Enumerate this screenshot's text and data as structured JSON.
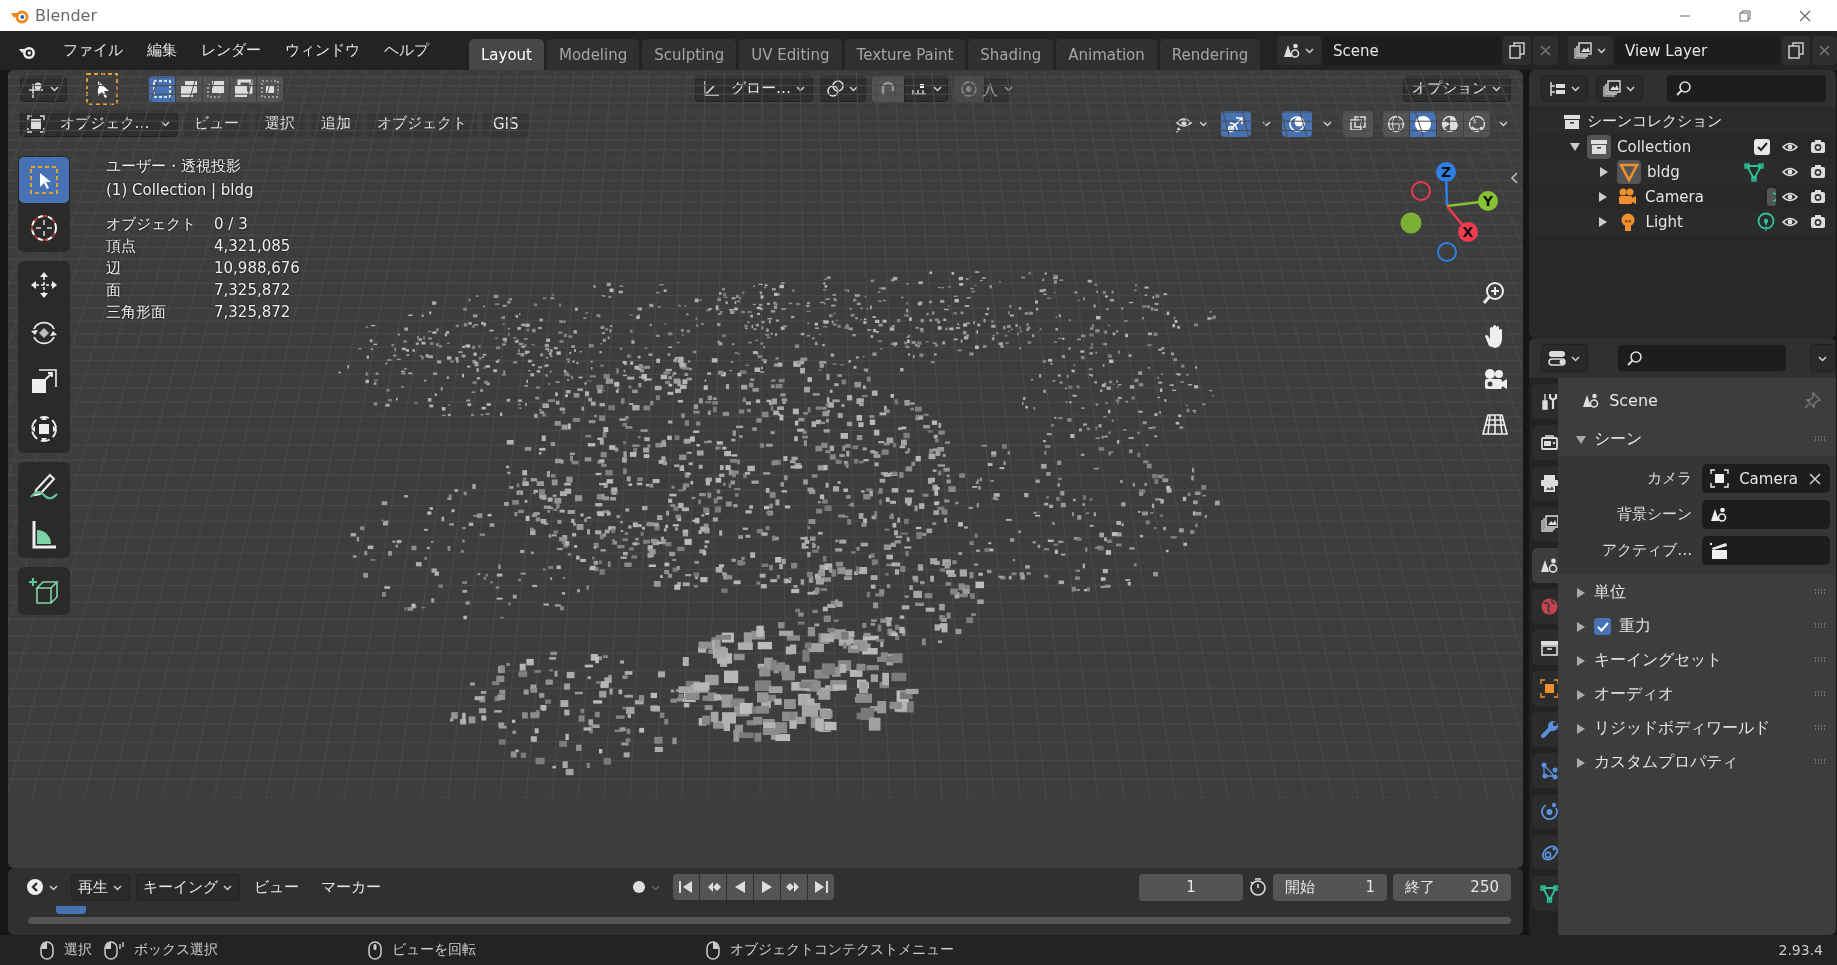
{
  "window": {
    "title": "Blender"
  },
  "menu": [
    "ファイル",
    "編集",
    "レンダー",
    "ウィンドウ",
    "ヘルプ"
  ],
  "workspaces": [
    {
      "label": "Layout",
      "selected": true
    },
    {
      "label": "Modeling",
      "selected": false
    },
    {
      "label": "Sculpting",
      "selected": false
    },
    {
      "label": "UV Editing",
      "selected": false
    },
    {
      "label": "Texture Paint",
      "selected": false
    },
    {
      "label": "Shading",
      "selected": false
    },
    {
      "label": "Animation",
      "selected": false
    },
    {
      "label": "Rendering",
      "selected": false
    }
  ],
  "scene": {
    "value": "Scene"
  },
  "view_layer": {
    "value": "View Layer"
  },
  "tool_header": {
    "select_modes": [
      {
        "kind": "set",
        "selected": true
      },
      {
        "kind": "extend",
        "selected": false
      },
      {
        "kind": "subtract",
        "selected": false
      },
      {
        "kind": "invert",
        "selected": false
      },
      {
        "kind": "intersect",
        "selected": false
      }
    ],
    "orientation": "グロー…",
    "options": "オプション"
  },
  "viewport_header": {
    "mode": "オブジェク…",
    "menus": [
      "ビュー",
      "選択",
      "追加",
      "オブジェクト",
      "GIS"
    ],
    "toggles": [
      {
        "kind": "gizmo",
        "on": true
      },
      {
        "kind": "overlay",
        "on": true
      },
      {
        "kind": "xray",
        "on": false
      }
    ],
    "shading": [
      {
        "kind": "wireframe",
        "selected": false
      },
      {
        "kind": "solid",
        "selected": true
      },
      {
        "kind": "material",
        "selected": false
      },
      {
        "kind": "rendered",
        "selected": false
      }
    ]
  },
  "tools": [
    {
      "kind": "select",
      "selected": true
    },
    {
      "kind": "cursor",
      "selected": false
    },
    {
      "kind": "move",
      "selected": false
    },
    {
      "kind": "rotate",
      "selected": false
    },
    {
      "kind": "scale",
      "selected": false
    },
    {
      "kind": "transform",
      "selected": false
    },
    {
      "kind": "annotate",
      "selected": false
    },
    {
      "kind": "measure",
      "selected": false
    },
    {
      "kind": "add_cube",
      "selected": false
    }
  ],
  "viewport_info": {
    "view": "ユーザー・透視投影",
    "context": "(1) Collection | bldg",
    "stats": [
      {
        "label": "オブジェクト",
        "value": "0 / 3"
      },
      {
        "label": "頂点",
        "value": "4,321,085"
      },
      {
        "label": "辺",
        "value": "10,988,676"
      },
      {
        "label": "面",
        "value": "7,325,872"
      },
      {
        "label": "三角形面",
        "value": "7,325,872"
      }
    ]
  },
  "gizmo": [
    {
      "label": "Z",
      "color": "#2e7fe6"
    },
    {
      "label": "Y",
      "color": "#86c232"
    },
    {
      "label": "X",
      "color": "#ef3a50"
    }
  ],
  "outliner": {
    "root": "シーンコレクション",
    "items": [
      {
        "label": "Collection",
        "kind": "collection",
        "expanded": true,
        "active": true,
        "checked": true,
        "children": [
          {
            "label": "bldg",
            "kind": "mesh",
            "expanded": false,
            "active": true
          },
          {
            "label": "Camera",
            "kind": "camera",
            "expanded": false,
            "active": false
          },
          {
            "label": "Light",
            "kind": "light",
            "expanded": false,
            "active": false
          }
        ]
      }
    ]
  },
  "properties": {
    "tabs": [
      {
        "kind": "tool",
        "selected": false
      },
      {
        "kind": "render",
        "selected": false
      },
      {
        "kind": "output",
        "selected": false
      },
      {
        "kind": "view_layer",
        "selected": false
      },
      {
        "kind": "scene",
        "selected": true
      },
      {
        "kind": "world",
        "selected": false
      },
      {
        "kind": "collection",
        "selected": false
      },
      {
        "kind": "object",
        "selected": false
      },
      {
        "kind": "modifier",
        "selected": false
      },
      {
        "kind": "particles",
        "selected": false
      },
      {
        "kind": "physics",
        "selected": false
      },
      {
        "kind": "constraints",
        "selected": false
      },
      {
        "kind": "data",
        "selected": false
      }
    ],
    "context": "Scene",
    "panels": [
      {
        "label": "シーン",
        "kind": "plain",
        "expanded": true,
        "fields": [
          {
            "label": "カメラ",
            "kind": "object",
            "value": "Camera"
          },
          {
            "label": "背景シーン",
            "kind": "scene"
          },
          {
            "label": "アクティブ…",
            "kind": "clip"
          }
        ]
      },
      {
        "label": "単位",
        "kind": "plain",
        "expanded": false
      },
      {
        "label": "重力",
        "kind": "checkbox",
        "expanded": false,
        "checked": true
      },
      {
        "label": "キーイングセット",
        "kind": "plain",
        "expanded": false
      },
      {
        "label": "オーディオ",
        "kind": "plain",
        "expanded": false
      },
      {
        "label": "リジッドボディワールド",
        "kind": "plain",
        "expanded": false
      },
      {
        "label": "カスタムプロパティ",
        "kind": "plain",
        "expanded": false
      }
    ]
  },
  "timeline": {
    "auto_keying": {
      "on": false
    },
    "menus": [
      {
        "label": "再生",
        "dropdown": true
      },
      {
        "label": "キーイング",
        "dropdown": true
      },
      {
        "label": "ビュー",
        "dropdown": false
      },
      {
        "label": "マーカー",
        "dropdown": false
      }
    ],
    "frame": "1",
    "start_label": "開始",
    "start": "1",
    "end_label": "終了",
    "end": "250"
  },
  "status_bar": {
    "hints": [
      {
        "kind": "left",
        "label": "選択"
      },
      {
        "kind": "left_drag",
        "label": "ボックス選択"
      },
      {
        "kind": "middle",
        "label": "ビューを回転"
      },
      {
        "kind": "right",
        "label": "オブジェクトコンテクストメニュー"
      }
    ],
    "version": "2.93.4"
  }
}
